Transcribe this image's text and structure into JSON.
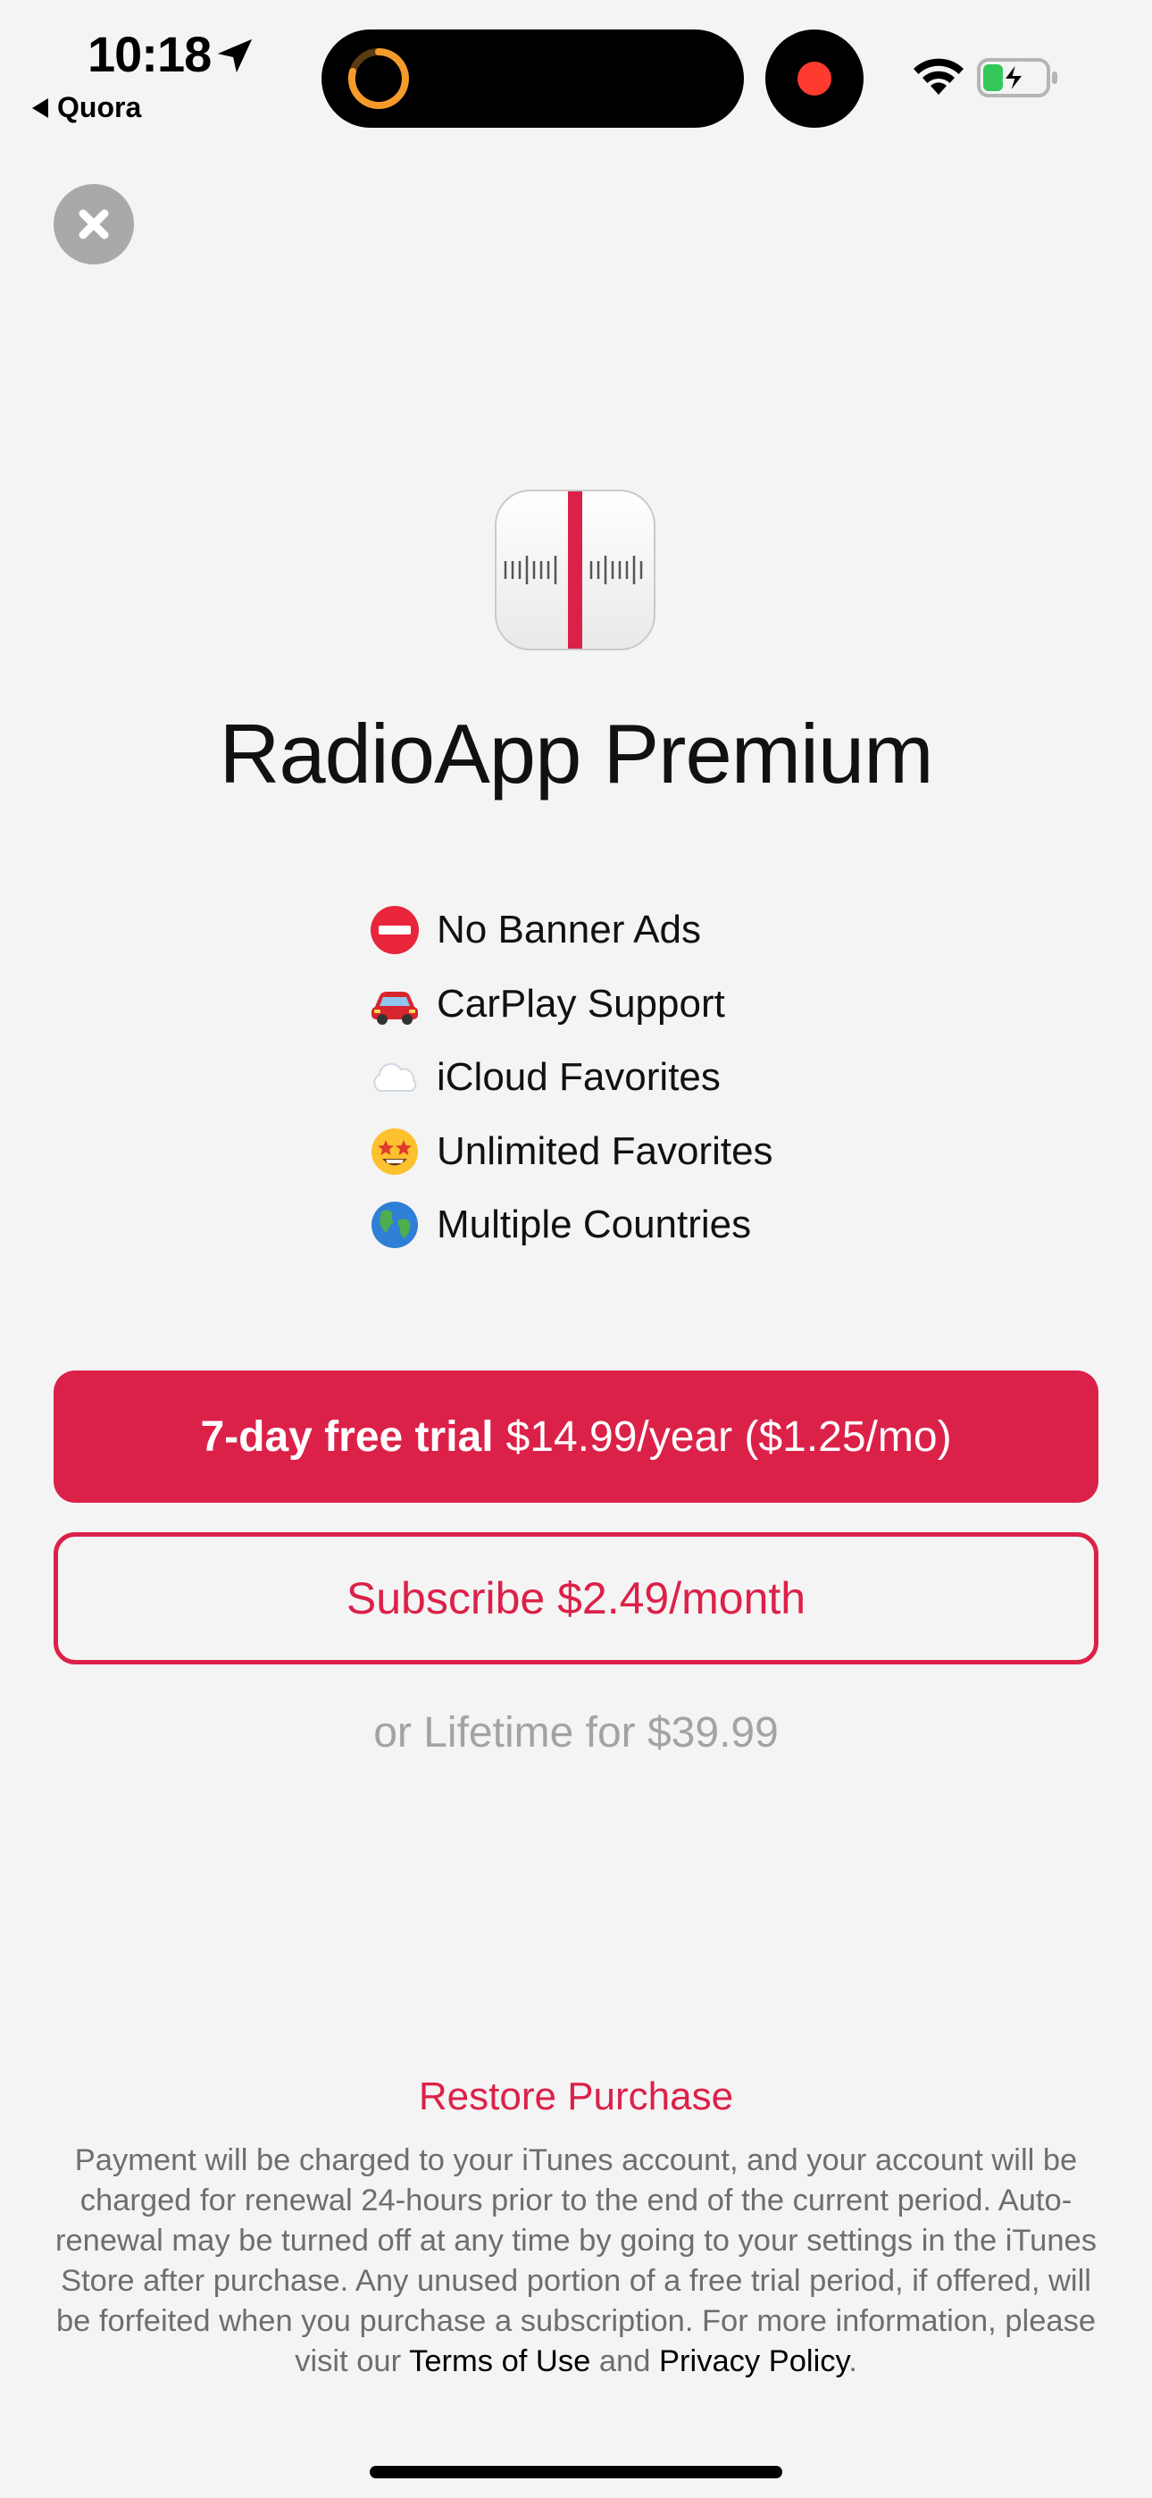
{
  "status_bar": {
    "time": "10:18",
    "back_app": "Quora"
  },
  "paywall": {
    "title": "RadioApp Premium",
    "features": [
      {
        "icon": "no-entry-icon",
        "label": "No Banner Ads"
      },
      {
        "icon": "car-icon",
        "label": "CarPlay Support"
      },
      {
        "icon": "cloud-icon",
        "label": "iCloud Favorites"
      },
      {
        "icon": "star-struck-icon",
        "label": "Unlimited Favorites"
      },
      {
        "icon": "globe-icon",
        "label": "Multiple Countries"
      }
    ],
    "trial_button": {
      "bold": "7-day free trial",
      "price": "$14.99/year ($1.25/mo)"
    },
    "subscribe_button": "Subscribe $2.49/month",
    "lifetime": "or Lifetime for $39.99",
    "restore": "Restore Purchase",
    "legal": {
      "text": "Payment will be charged to your iTunes account, and your account will be charged for renewal 24-hours prior to the end of the current period. Auto-renewal may be turned off at any time by going to your settings in the iTunes Store after purchase. Any unused portion of a free trial period, if offered, will be forfeited when you purchase a subscription. For more information, please visit our",
      "terms": "Terms of Use",
      "and": "and",
      "privacy": "Privacy Policy",
      "end": "."
    }
  },
  "colors": {
    "accent": "#dc2149",
    "background": "#f4f4f4",
    "muted": "#a3a3a3"
  }
}
